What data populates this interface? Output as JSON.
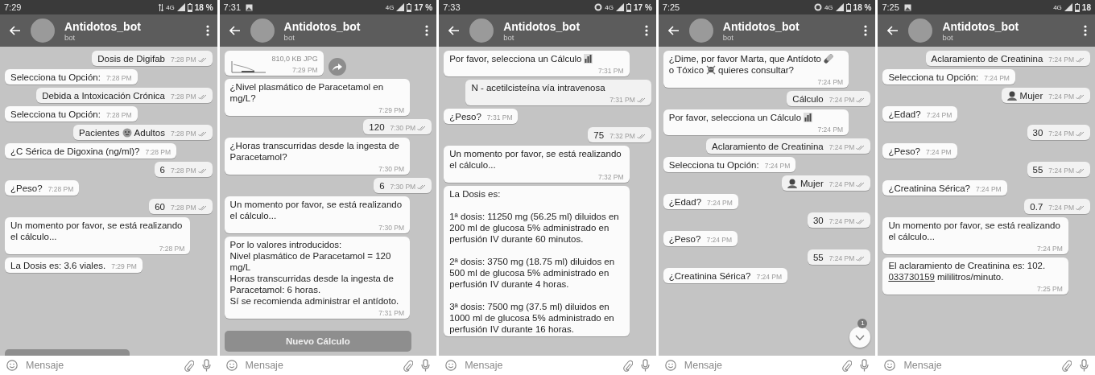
{
  "panels": [
    {
      "status": {
        "time": "7:29",
        "icons": [
          {
            "kind": "arrows"
          }
        ],
        "network": "4G",
        "battery": "18 %"
      },
      "header": {
        "title": "Antidotos_bot",
        "subtitle": "bot"
      },
      "messages": [
        {
          "kind": "out",
          "text": "Dosis de Digifab",
          "time": "7:28 PM"
        },
        {
          "kind": "in",
          "text": "Selecciona tu Opción:",
          "time": "7:28 PM"
        },
        {
          "kind": "out",
          "text": "Debida a Intoxicación Crónica",
          "time": "7:28 PM"
        },
        {
          "kind": "in",
          "text": "Selecciona tu Opción:",
          "time": "7:28 PM"
        },
        {
          "kind": "out",
          "parts": [
            {
              "kind": "text",
              "text": "Pacientes"
            },
            {
              "kind": "face"
            },
            {
              "kind": "text",
              "text": "Adultos"
            }
          ],
          "time": "7:28 PM"
        },
        {
          "kind": "in",
          "text": "¿C Sérica de Digoxina (ng/ml)?",
          "time": "7:28 PM"
        },
        {
          "kind": "out",
          "text": "6",
          "time": "7:28 PM"
        },
        {
          "kind": "in",
          "text": "¿Peso?",
          "time": "7:28 PM"
        },
        {
          "kind": "out",
          "text": "60",
          "time": "7:28 PM"
        },
        {
          "kind": "in",
          "text": "Un momento por favor, se está realizando el cálculo...",
          "time": "7:28 PM"
        },
        {
          "kind": "in",
          "text": "La Dosis es: 3.6 viales.",
          "time": "7:29 PM"
        }
      ],
      "keyboard": {
        "covered": true
      },
      "input": {
        "placeholder": "Mensaje"
      }
    },
    {
      "status": {
        "time": "7:31",
        "icons": [
          {
            "kind": "picture"
          }
        ],
        "network": "4G",
        "battery": "17 %"
      },
      "header": {
        "title": "Antidotos_bot",
        "subtitle": "bot"
      },
      "messages": [
        {
          "kind": "file",
          "caption": "810,0 KB JPG",
          "time": "7:29 PM"
        },
        {
          "kind": "in",
          "text": "¿Nivel plasmático de Paracetamol en mg/L?",
          "time": "7:29 PM"
        },
        {
          "kind": "out",
          "text": "120",
          "time": "7:30 PM"
        },
        {
          "kind": "in",
          "text": "¿Horas transcurridas desde la ingesta de Paracetamol?",
          "time": "7:30 PM"
        },
        {
          "kind": "out",
          "text": "6",
          "time": "7:30 PM"
        },
        {
          "kind": "in",
          "text": "Un momento por favor, se está realizando el cálculo...",
          "time": "7:30 PM"
        },
        {
          "kind": "in",
          "text": "Por lo valores introducidos:\nNivel plasmático de Paracetamol = 120 mg/L\nHoras transcurridas desde la ingesta de Paracetamol: 6 horas.\nSí se recomienda administrar el antídoto.",
          "time": "7:31 PM"
        }
      ],
      "keyboard": {
        "covered": false,
        "label": "Nuevo Cálculo"
      },
      "input": {
        "placeholder": "Mensaje"
      }
    },
    {
      "status": {
        "time": "7:33",
        "icons": [
          {
            "kind": "datasaver"
          }
        ],
        "network": "4G",
        "battery": "17 %"
      },
      "header": {
        "title": "Antidotos_bot",
        "subtitle": "bot"
      },
      "messages": [
        {
          "kind": "in",
          "parts": [
            {
              "kind": "text",
              "text": "Por favor, selecciona un Cálculo"
            },
            {
              "kind": "chart"
            }
          ],
          "time": "7:31 PM"
        },
        {
          "kind": "out",
          "text": "N - acetilcisteína vía intravenosa",
          "time": "7:31 PM"
        },
        {
          "kind": "in",
          "text": "¿Peso?",
          "time": "7:31 PM"
        },
        {
          "kind": "out",
          "text": "75",
          "time": "7:32 PM"
        },
        {
          "kind": "in",
          "text": "Un momento por favor, se está realizando el cálculo...",
          "time": "7:32 PM"
        },
        {
          "kind": "in",
          "text": "La Dosis es:\n\n1ª dosis: 11250 mg (56.25 ml) diluidos en 200 ml de glucosa 5% administrado en perfusión IV durante 60 minutos.\n\n2ª dosis: 3750 mg (18.75 ml) diluidos en 500 ml de glucosa 5% administrado en perfusión IV durante 4 horas.\n\n3ª dosis: 7500 mg (37.5 ml) diluidos en 1000 ml de glucosa 5% administrado en perfusión IV durante 16 horas."
        }
      ],
      "input": {
        "placeholder": "Mensaje"
      }
    },
    {
      "status": {
        "time": "7:25",
        "icons": [
          {
            "kind": "datasaver"
          }
        ],
        "network": "4G",
        "battery": "18 %"
      },
      "header": {
        "title": "Antidotos_bot",
        "subtitle": "bot"
      },
      "messages": [
        {
          "kind": "in",
          "parts": [
            {
              "kind": "text",
              "text": "¿Dime, por favor Marta, que Antídoto"
            },
            {
              "kind": "pill"
            },
            {
              "kind": "text",
              "text": "o Tóxico"
            },
            {
              "kind": "skull"
            },
            {
              "kind": "text",
              "text": "quieres consultar?"
            }
          ],
          "time": "7:24 PM"
        },
        {
          "kind": "out",
          "text": "Cálculo",
          "time": "7:24 PM"
        },
        {
          "kind": "in",
          "parts": [
            {
              "kind": "text",
              "text": "Por favor, selecciona un Cálculo"
            },
            {
              "kind": "chart"
            }
          ],
          "time": "7:24 PM"
        },
        {
          "kind": "out",
          "text": "Aclaramiento de Creatinina",
          "time": "7:24 PM"
        },
        {
          "kind": "in",
          "text": "Selecciona tu Opción:",
          "time": "7:24 PM"
        },
        {
          "kind": "out",
          "parts": [
            {
              "kind": "person"
            },
            {
              "kind": "text",
              "text": "Mujer"
            }
          ],
          "time": "7:24 PM"
        },
        {
          "kind": "in",
          "text": "¿Edad?",
          "time": "7:24 PM"
        },
        {
          "kind": "out",
          "text": "30",
          "time": "7:24 PM"
        },
        {
          "kind": "in",
          "text": "¿Peso?",
          "time": "7:24 PM"
        },
        {
          "kind": "out",
          "text": "55",
          "time": "7:24 PM"
        },
        {
          "kind": "in",
          "text": "¿Creatinina Sérica?",
          "time": "7:24 PM"
        }
      ],
      "scroll_down": {
        "badge": "1"
      },
      "input": {
        "placeholder": "Mensaje"
      }
    },
    {
      "status": {
        "time": "7:25",
        "icons": [
          {
            "kind": "picture"
          }
        ],
        "network": "4G",
        "battery": "18"
      },
      "header": {
        "title": "Antidotos_bot",
        "subtitle": "bot"
      },
      "messages": [
        {
          "kind": "out",
          "text": "Aclaramiento de Creatinina",
          "time": "7:24 PM"
        },
        {
          "kind": "in",
          "text": "Selecciona tu Opción:",
          "time": "7:24 PM"
        },
        {
          "kind": "out",
          "parts": [
            {
              "kind": "person"
            },
            {
              "kind": "text",
              "text": "Mujer"
            }
          ],
          "time": "7:24 PM"
        },
        {
          "kind": "in",
          "text": "¿Edad?",
          "time": "7:24 PM"
        },
        {
          "kind": "out",
          "text": "30",
          "time": "7:24 PM"
        },
        {
          "kind": "in",
          "text": "¿Peso?",
          "time": "7:24 PM"
        },
        {
          "kind": "out",
          "text": "55",
          "time": "7:24 PM"
        },
        {
          "kind": "in",
          "text": "¿Creatinina Sérica?",
          "time": "7:24 PM"
        },
        {
          "kind": "out",
          "text": "0.7",
          "time": "7:24 PM"
        },
        {
          "kind": "in",
          "text": "Un momento por favor, se está realizando el cálculo...",
          "time": "7:24 PM"
        },
        {
          "kind": "in",
          "parts": [
            {
              "kind": "text",
              "text": "El aclaramiento de Creatinina es:"
            },
            {
              "kind": "text",
              "text": "102."
            },
            {
              "kind": "link",
              "text": "033730159"
            },
            {
              "kind": "text",
              "text": "mililitros/minuto."
            }
          ],
          "time": "7:25 PM"
        }
      ],
      "input": {
        "placeholder": "Mensaje"
      }
    }
  ]
}
